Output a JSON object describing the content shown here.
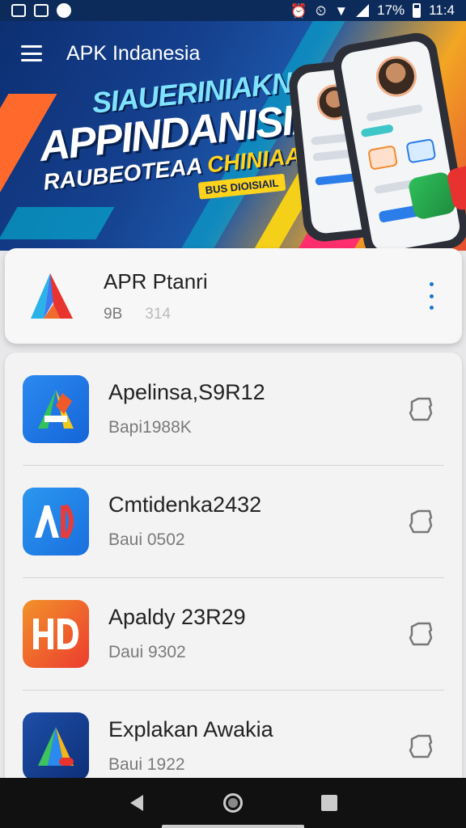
{
  "status_bar": {
    "battery": "17%",
    "time": "11:4"
  },
  "header": {
    "app_title": "APK Indanesia"
  },
  "hero": {
    "line1": "SIAUERINIAKN",
    "line2": "APPINDANISIA",
    "line3a": "RAUBEOTEAA",
    "line3b": "CHINIAA",
    "badge": "BUS DIOISIAIL",
    "accent_colors": [
      "#0d2f72",
      "#f2a623",
      "#e74d30",
      "#ff2f6d",
      "#f5d019"
    ]
  },
  "featured": {
    "name": "APR Ptanri",
    "size": "9B",
    "version": "314",
    "menu_icon": "kebab-menu-icon"
  },
  "apps": [
    {
      "name": "Apelinsa,S9R12",
      "meta": "Bapi1988K",
      "icon": "app-icon-a-blue",
      "action_icon": "download-icon"
    },
    {
      "name": "Cmtidenka2432",
      "meta": "Baui  0502",
      "icon": "app-icon-ad-blue",
      "action_icon": "download-icon"
    },
    {
      "name": "Apaldy 23R29",
      "meta": "Daui  9302",
      "icon": "app-icon-hd-orange",
      "action_icon": "download-icon"
    },
    {
      "name": "Explakan Awakia",
      "meta": "Baui 1922",
      "icon": "app-icon-a-navy",
      "action_icon": "download-icon"
    }
  ],
  "nav": {
    "back": "back-icon",
    "home": "home-icon",
    "recent": "recent-apps-icon"
  }
}
